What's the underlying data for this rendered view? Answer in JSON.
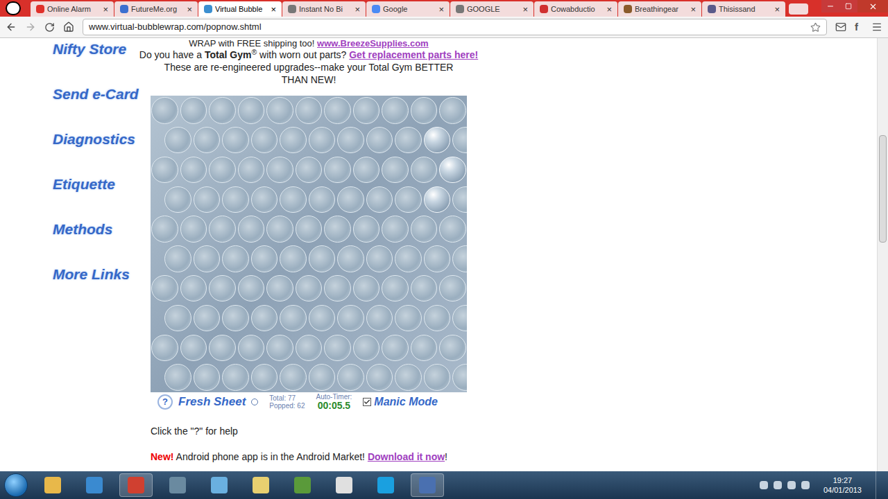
{
  "browser": {
    "tabs": [
      {
        "label": "Online Alarm",
        "selected": false,
        "color": "#e0302a"
      },
      {
        "label": "FutureMe.org",
        "selected": false,
        "color": "#3b6fd0"
      },
      {
        "label": "Virtual Bubble",
        "selected": true,
        "color": "#3b8fd0"
      },
      {
        "label": "Instant No Bi",
        "selected": false,
        "color": "#777777"
      },
      {
        "label": "Google",
        "selected": false,
        "color": "#4a8af4"
      },
      {
        "label": "GOOGLE",
        "selected": false,
        "color": "#777777"
      },
      {
        "label": "Cowabductio",
        "selected": false,
        "color": "#d03030"
      },
      {
        "label": "Breathingear",
        "selected": false,
        "color": "#8a5a2a"
      },
      {
        "label": "Thisissand",
        "selected": false,
        "color": "#5a5a8a"
      }
    ],
    "close_glyph": "×",
    "address": "www.virtual-bubblewrap.com/popnow.shtml",
    "menu_letter": "f"
  },
  "sidebar": {
    "items": [
      "Nifty Store",
      "Send e-Card",
      "Diagnostics",
      "Etiquette",
      "Methods",
      "More Links"
    ]
  },
  "page": {
    "promo": "WRAP with FREE shipping too!",
    "promo_link": "www.BreezeSupplies.com",
    "gym_prefix": "Do you have a",
    "gym_brand": "Total Gym",
    "reg": "®",
    "gym_suffix": "with worn out parts?",
    "gym_link": "Get replacement parts here!",
    "upgrades": "These are re-engineered upgrades--make your Total Gym BETTER THAN NEW!",
    "help": "Click the \"?\" for help",
    "new_badge": "New!",
    "android": "Android phone app is in the Android Market!",
    "download_link": "Download it now",
    "download_end": "!"
  },
  "bubble_sheet": {
    "rows": [
      [
        true,
        true,
        true,
        true,
        true,
        true,
        true,
        true,
        true,
        true,
        true
      ],
      [
        true,
        true,
        true,
        true,
        true,
        true,
        true,
        true,
        true,
        false,
        true
      ],
      [
        true,
        true,
        true,
        true,
        true,
        true,
        true,
        true,
        true,
        true,
        false
      ],
      [
        true,
        true,
        true,
        true,
        true,
        true,
        true,
        true,
        true,
        false,
        true
      ],
      [
        true,
        true,
        true,
        true,
        true,
        true,
        true,
        true,
        true,
        true,
        true
      ],
      [
        true,
        true,
        true,
        true,
        true,
        true,
        true,
        true,
        true,
        true,
        true
      ],
      [
        true,
        true,
        true,
        true,
        true,
        true,
        true,
        true,
        true,
        true,
        true
      ],
      [
        true,
        true,
        true,
        true,
        true,
        true,
        true,
        true,
        true,
        true,
        true
      ],
      [
        true,
        true,
        true,
        true,
        true,
        true,
        true,
        true,
        true,
        true,
        true
      ],
      [
        true,
        true,
        true,
        true,
        true,
        true,
        true,
        true,
        true,
        true,
        true
      ]
    ]
  },
  "controls": {
    "help_button": "?",
    "fresh_sheet": "Fresh Sheet",
    "total_label": "Total:",
    "total": "77",
    "popped_label": "Popped:",
    "popped": "62",
    "timer_label": "Auto-Timer:",
    "timer": "00:05.5",
    "manic_mode": {
      "label": "Manic Mode",
      "checked": true
    }
  },
  "taskbar": {
    "time": "19:27",
    "date": "04/01/2013"
  }
}
